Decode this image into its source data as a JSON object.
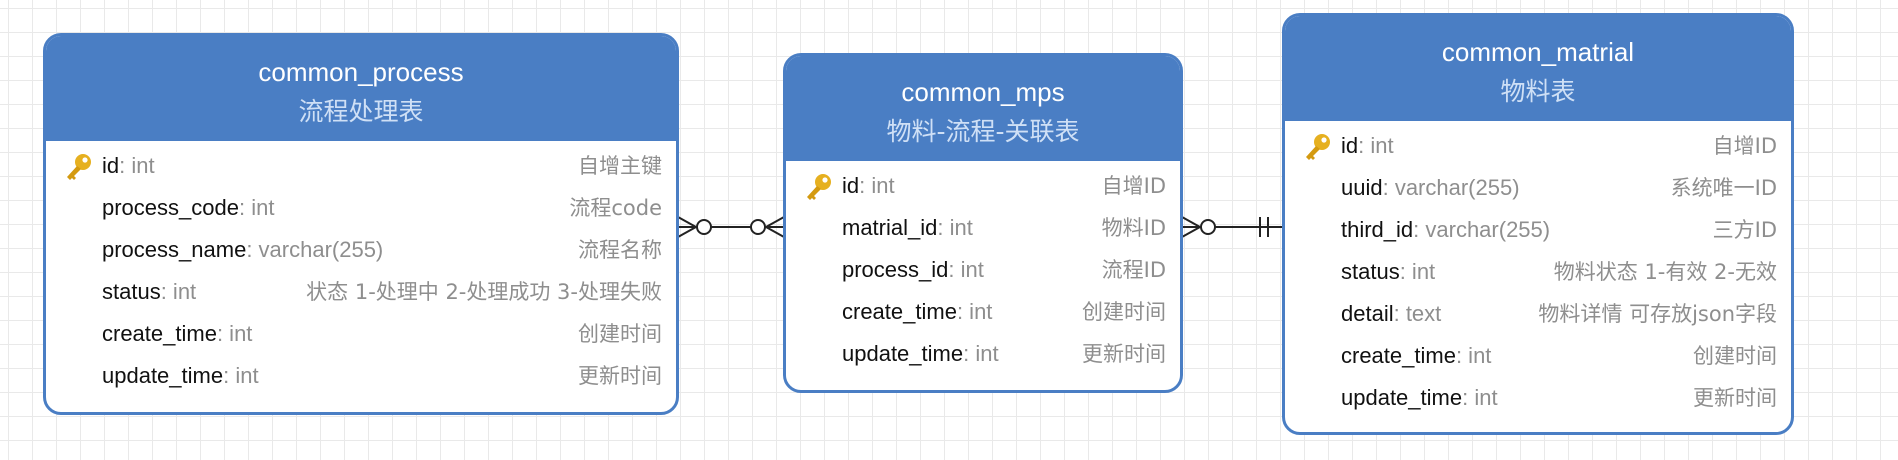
{
  "tables": {
    "process": {
      "name": "common_process",
      "comment": "流程处理表",
      "fields": [
        {
          "name": "id",
          "type": ": int",
          "comment": "自增主键",
          "pk": true
        },
        {
          "name": "process_code",
          "type": ": int",
          "comment": "流程code"
        },
        {
          "name": "process_name",
          "type": ": varchar(255)",
          "comment": "流程名称"
        },
        {
          "name": "status",
          "type": ": int",
          "comment": "状态 1-处理中 2-处理成功 3-处理失败"
        },
        {
          "name": "create_time",
          "type": ": int",
          "comment": "创建时间"
        },
        {
          "name": "update_time",
          "type": ": int",
          "comment": "更新时间"
        }
      ]
    },
    "mps": {
      "name": "common_mps",
      "comment": "物料-流程-关联表",
      "fields": [
        {
          "name": "id",
          "type": ": int",
          "comment": "自增ID",
          "pk": true
        },
        {
          "name": "matrial_id",
          "type": ": int",
          "comment": "物料ID"
        },
        {
          "name": "process_id",
          "type": ": int",
          "comment": "流程ID"
        },
        {
          "name": "create_time",
          "type": ": int",
          "comment": "创建时间"
        },
        {
          "name": "update_time",
          "type": ": int",
          "comment": "更新时间"
        }
      ]
    },
    "matrial": {
      "name": "common_matrial",
      "comment": "物料表",
      "fields": [
        {
          "name": "id",
          "type": ": int",
          "comment": "自增ID",
          "pk": true
        },
        {
          "name": "uuid",
          "type": ": varchar(255)",
          "comment": "系统唯一ID"
        },
        {
          "name": "third_id",
          "type": ": varchar(255)",
          "comment": "三方ID"
        },
        {
          "name": "status",
          "type": ": int",
          "comment": "物料状态 1-有效 2-无效"
        },
        {
          "name": "detail",
          "type": ": text",
          "comment": "物料详情 可存放json字段"
        },
        {
          "name": "create_time",
          "type": ": int",
          "comment": "创建时间"
        },
        {
          "name": "update_time",
          "type": ": int",
          "comment": "更新时间"
        }
      ]
    }
  },
  "relations": [
    {
      "from": "common_process",
      "to": "common_mps",
      "type": "zero-or-many to zero-or-many"
    },
    {
      "from": "common_mps",
      "to": "common_matrial",
      "type": "zero-or-many to exactly-one"
    }
  ],
  "colors": {
    "header": "#4a7ec4",
    "border": "#4a7ec4",
    "comment": "#cfe0f6",
    "key_icon": "#e6b020",
    "line": "#222222"
  },
  "icons": {
    "primary_key": "key-icon"
  }
}
